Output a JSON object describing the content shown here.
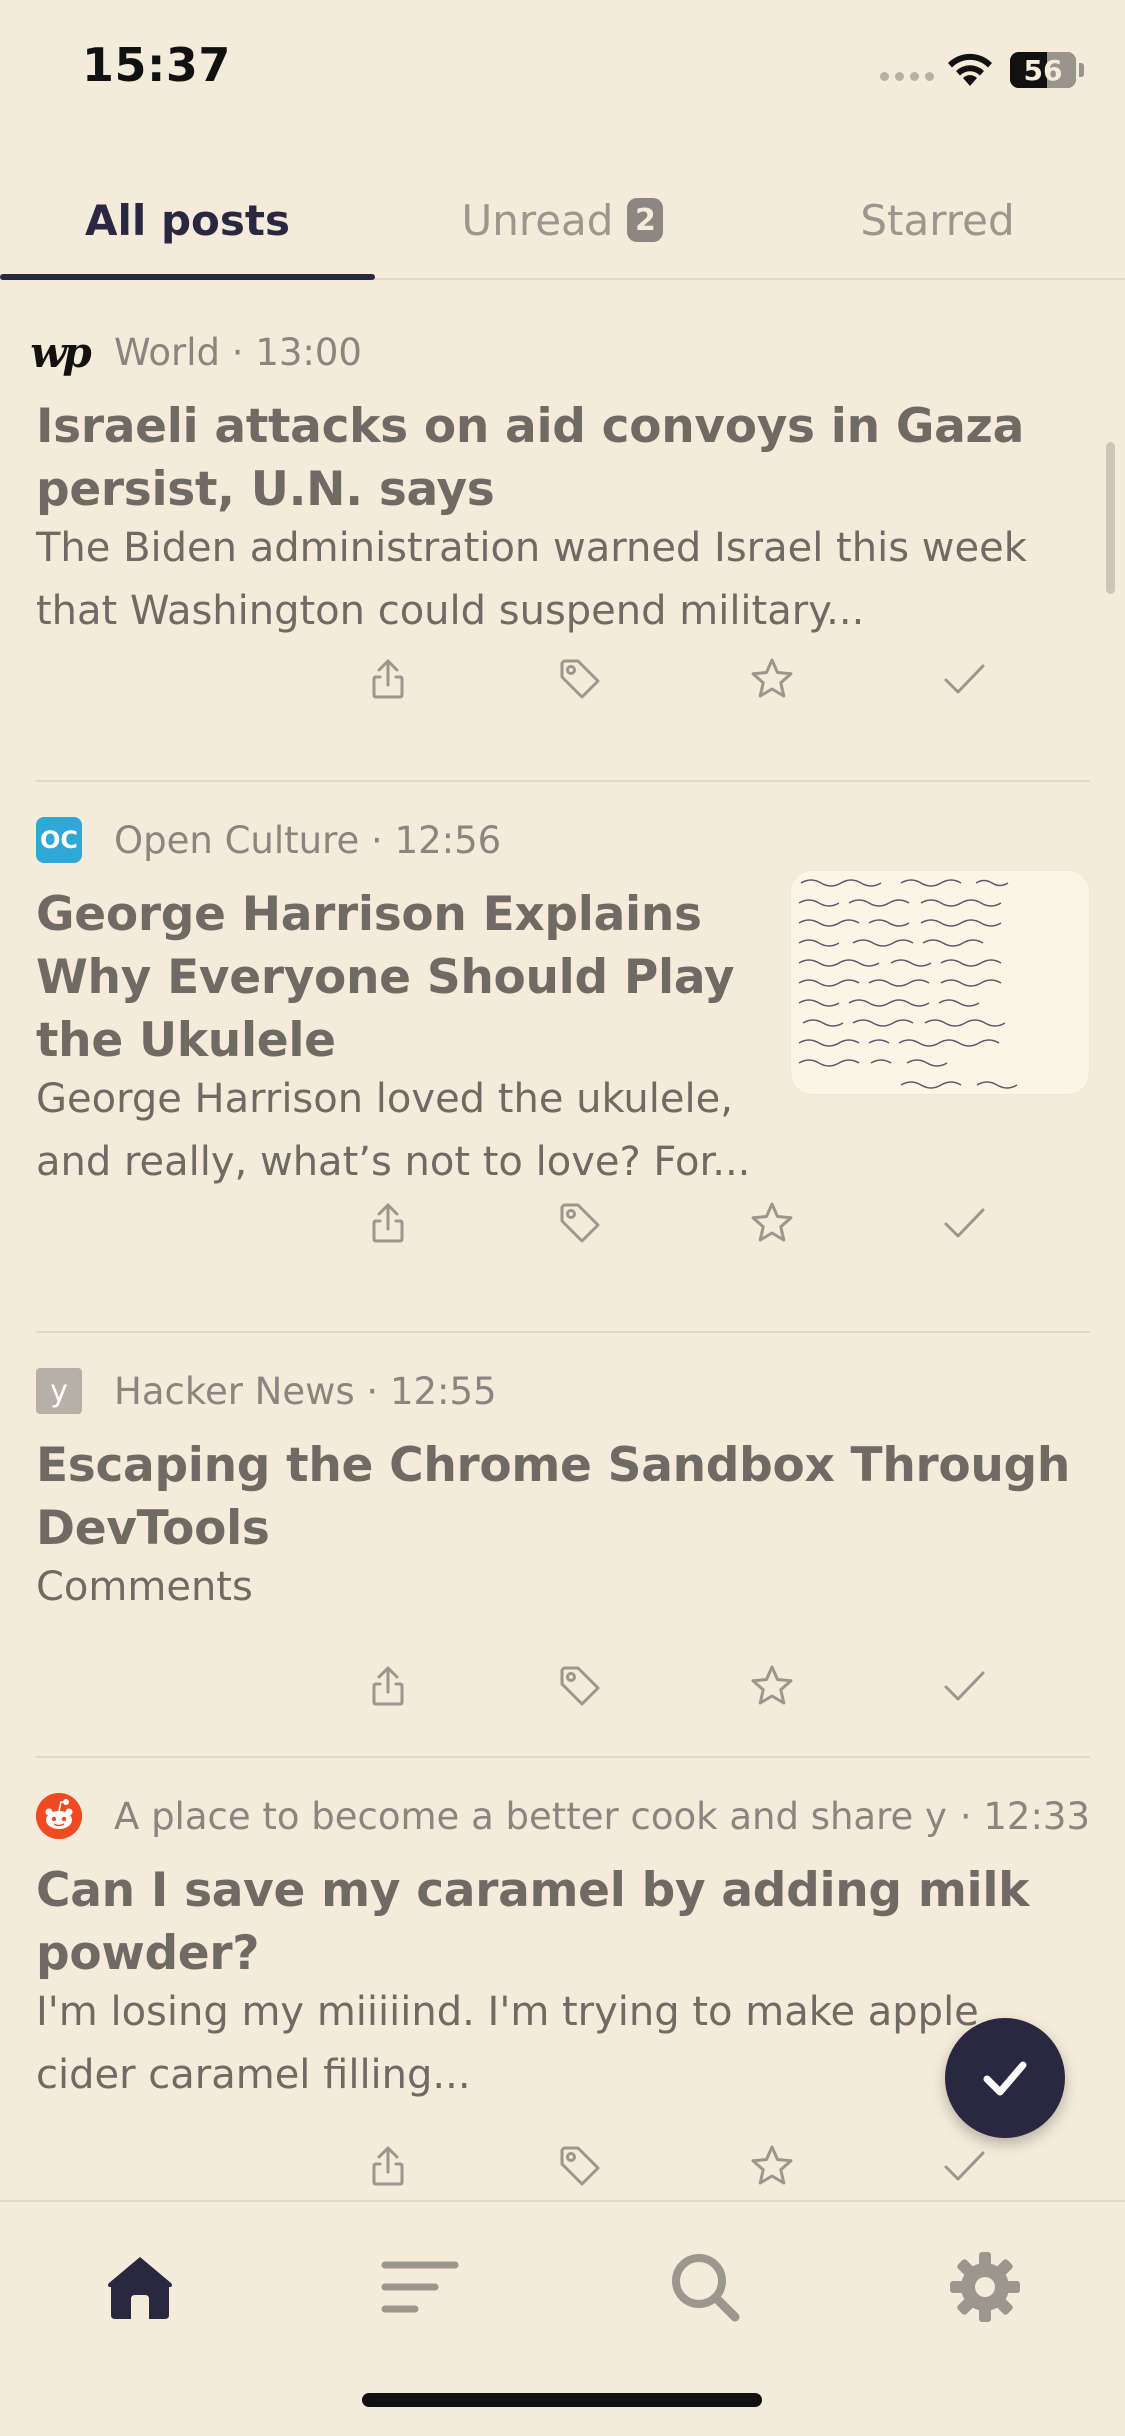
{
  "status_bar": {
    "time": "15:37",
    "battery_level": "56",
    "battery_fraction": 0.56
  },
  "tabs": [
    {
      "label": "All posts",
      "selected": true
    },
    {
      "label": "Unread",
      "badge": "2"
    },
    {
      "label": "Starred"
    }
  ],
  "posts": [
    {
      "source": "World",
      "time": "13:00",
      "logo_icon": "washington-post-logo",
      "title": "Israeli attacks on aid convoys in Gaza persist, U.N. says",
      "excerpt": "The Biden administration warned Israel this week that Washington could suspend military..."
    },
    {
      "source": "Open Culture",
      "time": "12:56",
      "logo_icon": "open-culture-logo",
      "logo_text": "OC",
      "title": "George Harrison Explains Why Everyone Should Play the Ukulele",
      "excerpt": "George Harrison loved the ukulele, and really, what’s not to love? For...",
      "thumbnail_icon": "handwritten-note-image"
    },
    {
      "source": "Hacker News",
      "time": "12:55",
      "logo_icon": "hacker-news-logo",
      "logo_text": "y",
      "title": "Escaping the Chrome Sandbox Through DevTools",
      "excerpt": "Comments"
    },
    {
      "source": "A place to become a better cook and share yo...",
      "time": "12:33",
      "logo_icon": "reddit-logo",
      "title": "Can I save my caramel by adding milk powder?",
      "excerpt": "I'm losing my miiiiind. I'm trying to make apple cider caramel filling..."
    }
  ],
  "post_actions": [
    "share-icon",
    "tag-icon",
    "star-icon",
    "mark-read-check-icon"
  ],
  "fab": {
    "icon": "checkmark-icon"
  },
  "bottom_nav": [
    {
      "icon": "home-icon",
      "selected": true
    },
    {
      "icon": "feeds-list-icon"
    },
    {
      "icon": "search-icon"
    },
    {
      "icon": "settings-gear-icon"
    }
  ],
  "colors": {
    "background": "#F5EBDA",
    "accent": "#2A2740",
    "muted_text": "#6F6A63",
    "inactive": "#9B968E"
  }
}
